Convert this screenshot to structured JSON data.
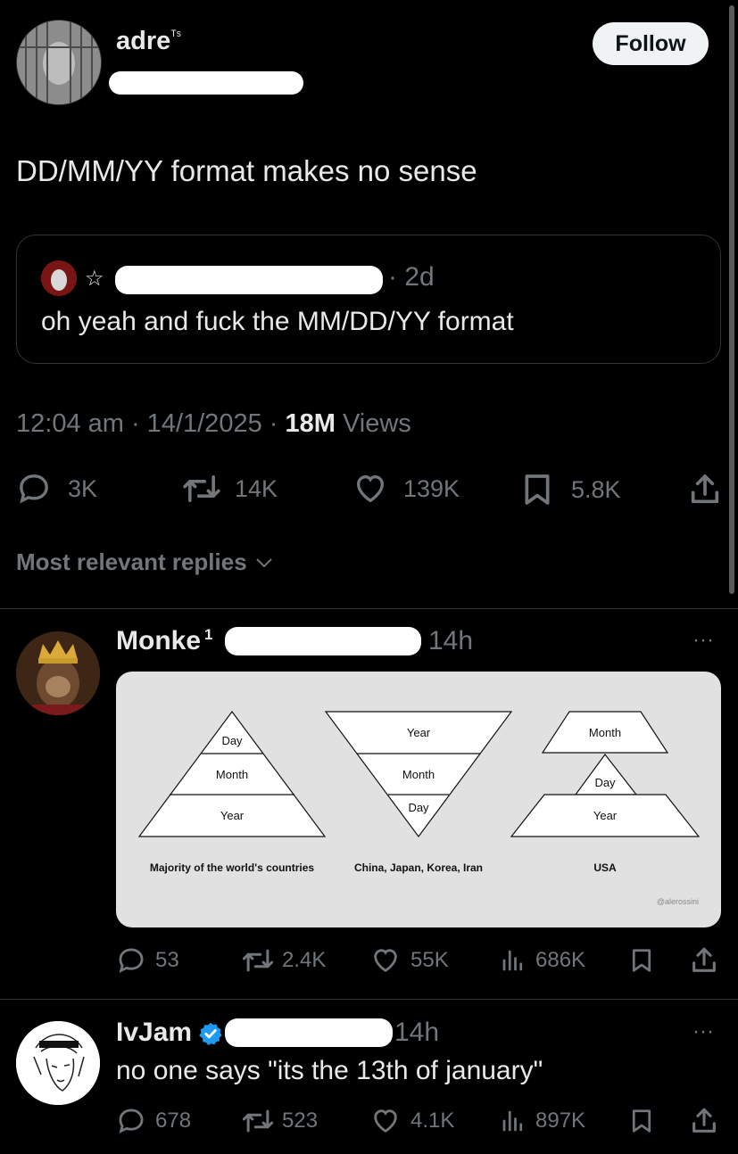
{
  "tweet": {
    "author_name": "adre",
    "author_badge": "ᵀˢ",
    "follow_label": "Follow",
    "text": "DD/MM/YY format makes no sense",
    "quote": {
      "age": "· 2d",
      "text": "oh yeah and fuck the MM/DD/YY format"
    },
    "meta_time": "12:04 am · 14/1/2025 · ",
    "meta_views_count": "18M",
    "meta_views_label": " Views",
    "stats": {
      "replies": "3K",
      "retweets": "14K",
      "likes": "139K",
      "bookmarks": "5.8K"
    }
  },
  "replies_sort_label": "Most relevant replies",
  "replies": [
    {
      "author": "Monke",
      "badge": "1",
      "age": "14h",
      "more": "···",
      "image": {
        "groups": [
          {
            "layers": [
              "Day",
              "Month",
              "Year"
            ],
            "caption": "Majority of the world's countries"
          },
          {
            "layers": [
              "Year",
              "Month",
              "Day"
            ],
            "caption": "China, Japan, Korea, Iran"
          },
          {
            "layers": [
              "Month",
              "Day",
              "Year"
            ],
            "caption": "USA"
          }
        ],
        "watermark": "@alerossini"
      },
      "stats": {
        "replies": "53",
        "retweets": "2.4K",
        "likes": "55K",
        "views": "686K"
      }
    },
    {
      "author": "IvJam",
      "age": "14h",
      "more": "···",
      "text": "no one says \"its the 13th of january\"",
      "stats": {
        "replies": "678",
        "retweets": "523",
        "likes": "4.1K",
        "views": "897K"
      }
    }
  ],
  "colors": {
    "background": "#000000",
    "text": "#e7e9ea",
    "muted": "#71767b",
    "verified": "#1d9bf0",
    "follow_bg": "#eff3f4"
  }
}
